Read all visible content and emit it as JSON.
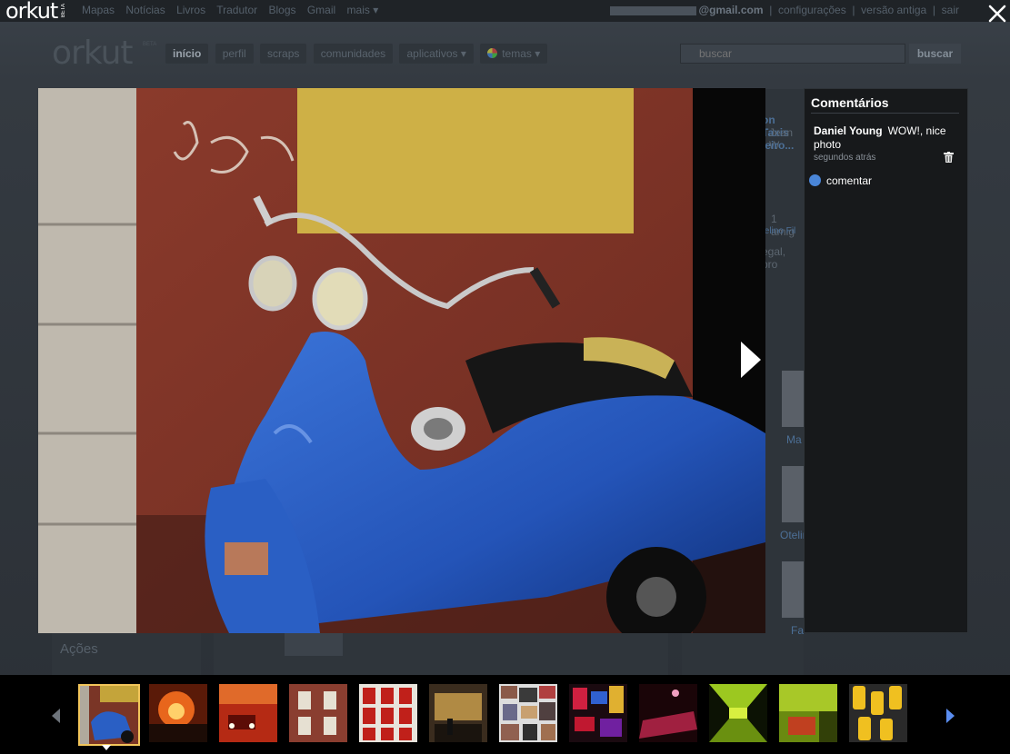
{
  "topbar": {
    "logo": "orkut",
    "beta": "BETA",
    "links": [
      "Mapas",
      "Notícias",
      "Livros",
      "Tradutor",
      "Blogs",
      "Gmail",
      "mais ▾"
    ],
    "email_suffix": "@gmail.com",
    "account_links": [
      "configurações",
      "versão antiga",
      "sair"
    ]
  },
  "nav": {
    "logo": "orkut",
    "beta": "BETA",
    "tabs": [
      "início",
      "perfil",
      "scraps",
      "comunidades",
      "aplicativos ▾",
      "temas ▾"
    ],
    "search_placeholder": "buscar",
    "search_button": "buscar"
  },
  "left": {
    "acoes": "Ações"
  },
  "right_peek": {
    "texts": [
      "on Taxis",
      "Jean W",
      "leiro...",
      "1 amig",
      "telino Fil",
      "egal, pro",
      "Ma",
      "Otelin",
      "Fa"
    ]
  },
  "comments": {
    "title": "Comentários",
    "author": "Daniel Young",
    "text": "WOW!, nice photo",
    "time": "segundos atrás",
    "action": "comentar"
  },
  "filmstrip": {
    "selected_index": 0,
    "thumbs": [
      "blue-scooter",
      "fire",
      "red-street",
      "brick-building",
      "soup-cans",
      "golden-painting",
      "collage",
      "times-square",
      "pool-table",
      "green-tunnel",
      "green-room",
      "yellow-taxis"
    ]
  },
  "colors": {
    "selected_border": "#f2c55a",
    "scooter_blue": "#2a5fc4",
    "wall_red": "#8c3a2a",
    "wall_yellow": "#c9a93a"
  }
}
